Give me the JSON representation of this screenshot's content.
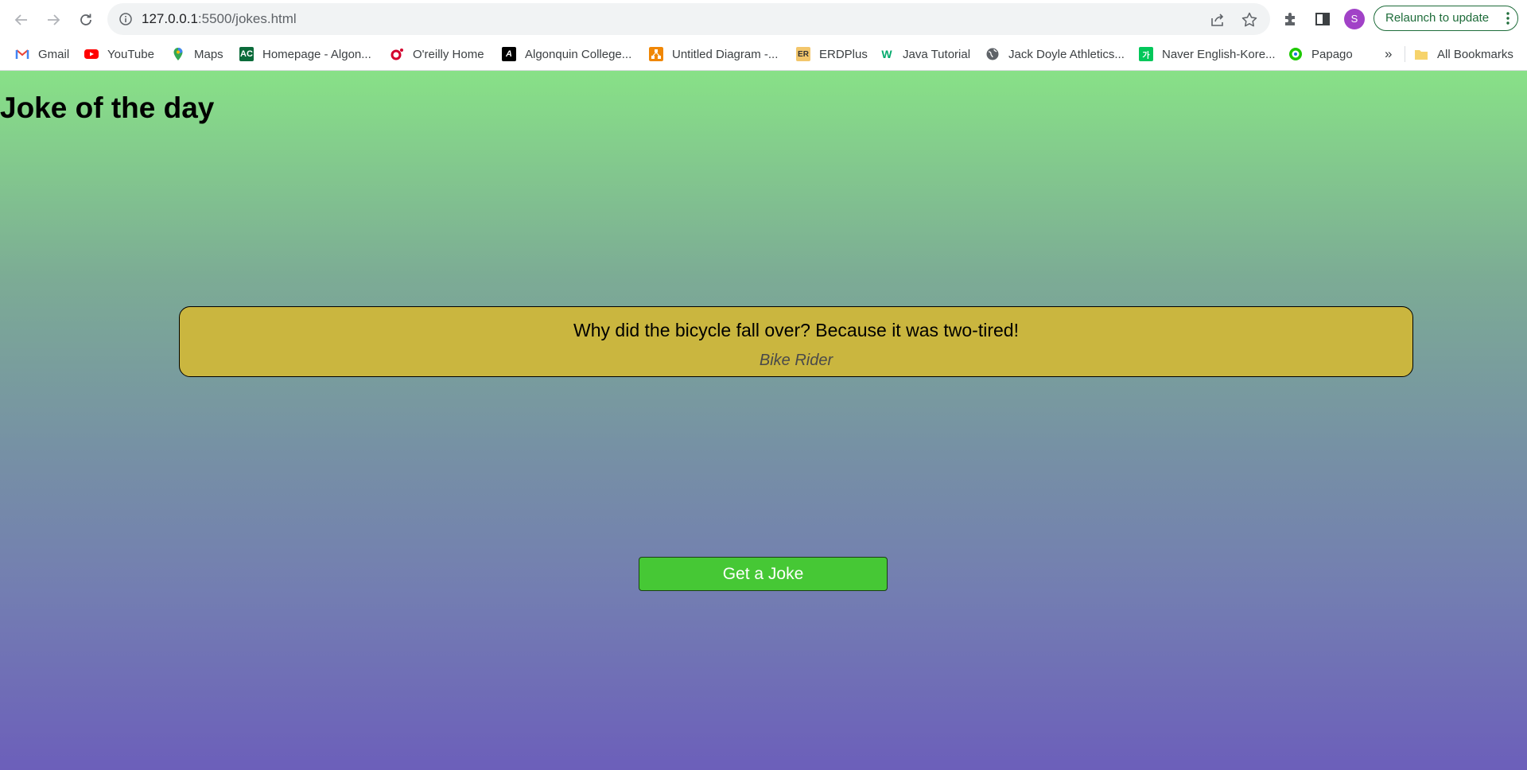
{
  "browser": {
    "url_host": "127.0.0.1",
    "url_path": ":5500/jokes.html",
    "profile_initial": "S",
    "relaunch_label": "Relaunch to update",
    "icons": {
      "back": "arrow-left-icon",
      "forward": "arrow-right-icon",
      "reload": "reload-icon",
      "site_info": "info-icon",
      "share": "share-icon",
      "bookmark": "star-icon",
      "extensions": "puzzle-icon",
      "side_panel": "side-panel-icon",
      "menu": "kebab-menu-icon"
    }
  },
  "bookmarks": {
    "items": [
      {
        "label": "Gmail",
        "icon": "gmail-icon",
        "color": "#ea4335"
      },
      {
        "label": "YouTube",
        "icon": "youtube-icon",
        "color": "#ff0000"
      },
      {
        "label": "Maps",
        "icon": "maps-pin-icon",
        "color": "#34a853"
      },
      {
        "label": "Homepage - Algon...",
        "icon": "ac-logo-icon",
        "color": "#0b6b3a"
      },
      {
        "label": "O'reilly Home",
        "icon": "oreilly-icon",
        "color": "#d3002d"
      },
      {
        "label": "Algonquin College...",
        "icon": "algonquin-a-icon",
        "color": "#000000"
      },
      {
        "label": "Untitled Diagram -...",
        "icon": "drawio-icon",
        "color": "#f08705"
      },
      {
        "label": "ERDPlus",
        "icon": "er-icon",
        "color": "#f3c66b"
      },
      {
        "label": "Java Tutorial",
        "icon": "w3schools-icon",
        "color": "#04aa6d"
      },
      {
        "label": "Jack Doyle Athletics...",
        "icon": "globe-icon",
        "color": "#5f6368"
      },
      {
        "label": "Naver English-Kore...",
        "icon": "naver-dict-icon",
        "color": "#03c75a"
      },
      {
        "label": "Papago",
        "icon": "papago-icon",
        "color": "#1ec800"
      }
    ],
    "overflow_label": "»",
    "all_bookmarks_label": "All Bookmarks"
  },
  "page": {
    "title": "Joke of the day",
    "joke": {
      "text": "Why did the bicycle fall over? Because it was two-tired!",
      "author": "Bike Rider"
    },
    "button_label": "Get a Joke"
  }
}
